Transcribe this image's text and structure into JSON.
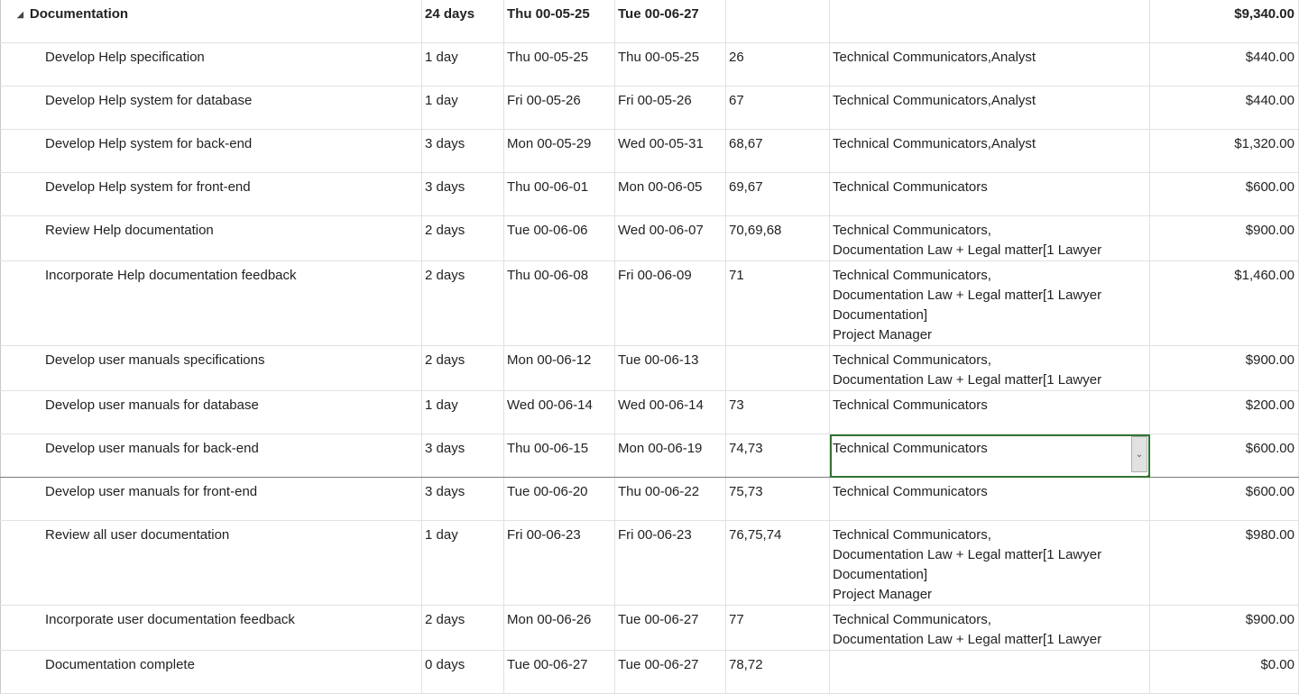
{
  "summary": {
    "name": "Documentation",
    "duration": "24 days",
    "start": "Thu 00-05-25",
    "finish": "Tue 00-06-27",
    "predecessors": "",
    "resources": "",
    "cost": "$9,340.00"
  },
  "tasks": [
    {
      "name": "Develop Help specification",
      "duration": "1 day",
      "start": "Thu 00-05-25",
      "finish": "Thu 00-05-25",
      "predecessors": "26",
      "resources": "Technical Communicators,Analyst",
      "cost": "$440.00"
    },
    {
      "name": "Develop Help system for database",
      "duration": "1 day",
      "start": "Fri 00-05-26",
      "finish": "Fri 00-05-26",
      "predecessors": "67",
      "resources": "Technical Communicators,Analyst",
      "cost": "$440.00"
    },
    {
      "name": "Develop Help system for back-end",
      "duration": "3 days",
      "start": "Mon 00-05-29",
      "finish": "Wed 00-05-31",
      "predecessors": "68,67",
      "resources": "Technical Communicators,Analyst",
      "cost": "$1,320.00"
    },
    {
      "name": "Develop Help system for front-end",
      "duration": "3 days",
      "start": "Thu 00-06-01",
      "finish": "Mon 00-06-05",
      "predecessors": "69,67",
      "resources": "Technical Communicators",
      "cost": "$600.00"
    },
    {
      "name": "Review Help documentation",
      "duration": "2 days",
      "start": "Tue 00-06-06",
      "finish": "Wed 00-06-07",
      "predecessors": "70,69,68",
      "resources": "Technical Communicators,\nDocumentation Law + Legal matter[1 Lawyer",
      "cost": "$900.00"
    },
    {
      "name": "Incorporate Help documentation feedback",
      "duration": "2 days",
      "start": "Thu 00-06-08",
      "finish": "Fri 00-06-09",
      "predecessors": "71",
      "resources": "Technical Communicators,\nDocumentation Law + Legal matter[1 Lawyer\nDocumentation]\nProject Manager",
      "cost": "$1,460.00"
    },
    {
      "name": "Develop user manuals specifications",
      "duration": "2 days",
      "start": "Mon 00-06-12",
      "finish": "Tue 00-06-13",
      "predecessors": "",
      "resources": "Technical Communicators,\nDocumentation Law + Legal matter[1 Lawyer",
      "cost": "$900.00"
    },
    {
      "name": "Develop user manuals for database",
      "duration": "1 day",
      "start": "Wed 00-06-14",
      "finish": "Wed 00-06-14",
      "predecessors": "73",
      "resources": "Technical Communicators",
      "cost": "$200.00"
    },
    {
      "name": "Develop user manuals for back-end",
      "duration": "3 days",
      "start": "Thu 00-06-15",
      "finish": "Mon 00-06-19",
      "predecessors": "74,73",
      "resources": "Technical Communicators",
      "cost": "$600.00"
    },
    {
      "name": "Develop user manuals for front-end",
      "duration": "3 days",
      "start": "Tue 00-06-20",
      "finish": "Thu 00-06-22",
      "predecessors": "75,73",
      "resources": "Technical Communicators",
      "cost": "$600.00"
    },
    {
      "name": "Review all user documentation",
      "duration": "1 day",
      "start": "Fri 00-06-23",
      "finish": "Fri 00-06-23",
      "predecessors": "76,75,74",
      "resources": "Technical Communicators,\nDocumentation Law + Legal matter[1 Lawyer\nDocumentation]\nProject Manager",
      "cost": "$980.00"
    },
    {
      "name": "Incorporate user documentation feedback",
      "duration": "2 days",
      "start": "Mon 00-06-26",
      "finish": "Tue 00-06-27",
      "predecessors": "77",
      "resources": "Technical Communicators,\nDocumentation Law + Legal matter[1 Lawyer",
      "cost": "$900.00"
    },
    {
      "name": "Documentation complete",
      "duration": "0 days",
      "start": "Tue 00-06-27",
      "finish": "Tue 00-06-27",
      "predecessors": "78,72",
      "resources": "",
      "cost": "$0.00"
    }
  ],
  "selected_row": 8
}
